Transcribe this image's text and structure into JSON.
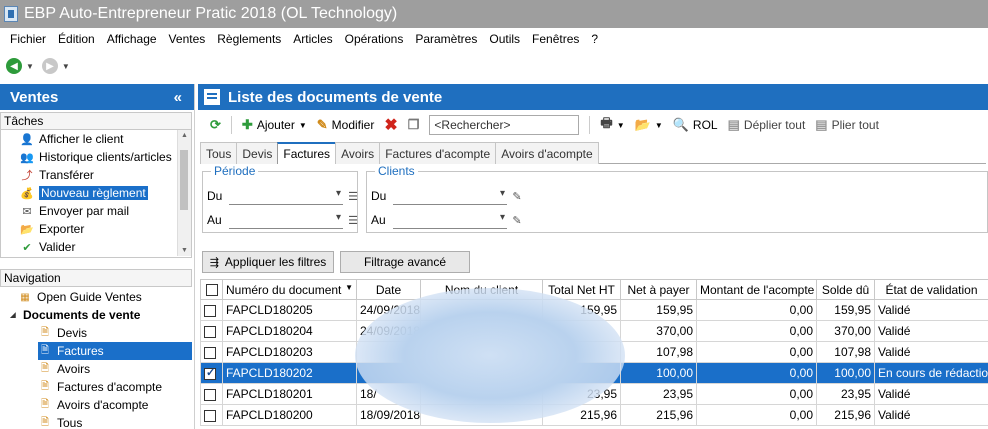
{
  "window": {
    "title": "EBP Auto-Entrepreneur Pratic 2018 (OL Technology)"
  },
  "menu": [
    "Fichier",
    "Édition",
    "Affichage",
    "Ventes",
    "Règlements",
    "Articles",
    "Opérations",
    "Paramètres",
    "Outils",
    "Fenêtres",
    "?"
  ],
  "left_panel": {
    "title": "Ventes",
    "collapse_glyph": "«",
    "tasks_label": "Tâches",
    "tasks": [
      {
        "label": "Afficher le client",
        "icon": "person-icon"
      },
      {
        "label": "Historique clients/articles",
        "icon": "people-icon"
      },
      {
        "label": "Transférer",
        "icon": "transfer-icon"
      },
      {
        "label": "Nouveau règlement",
        "icon": "payment-icon",
        "selected": true
      },
      {
        "label": "Envoyer par mail",
        "icon": "mail-icon"
      },
      {
        "label": "Exporter",
        "icon": "export-icon"
      },
      {
        "label": "Valider",
        "icon": "check-icon"
      }
    ],
    "navigation_label": "Navigation",
    "nav": [
      {
        "label": "Open Guide Ventes",
        "icon": "guide-icon"
      },
      {
        "label": "Documents de vente",
        "bold": true
      },
      {
        "label": "Devis",
        "icon": "document-icon"
      },
      {
        "label": "Factures",
        "icon": "document-icon",
        "selected": true
      },
      {
        "label": "Avoirs",
        "icon": "document-icon"
      },
      {
        "label": "Factures d'acompte",
        "icon": "document-icon"
      },
      {
        "label": "Avoirs d'acompte",
        "icon": "document-icon"
      },
      {
        "label": "Tous",
        "icon": "document-icon"
      }
    ]
  },
  "main": {
    "title": "Liste des documents de vente",
    "toolbar": {
      "add": "Ajouter",
      "edit": "Modifier",
      "search_placeholder": "<Rechercher>",
      "rol": "ROL",
      "expand": "Déplier tout",
      "collapse": "Plier tout"
    },
    "tabs": [
      "Tous",
      "Devis",
      "Factures",
      "Avoirs",
      "Factures d'acompte",
      "Avoirs d'acompte"
    ],
    "active_tab": "Factures",
    "filters": {
      "period_legend": "Période",
      "clients_legend": "Clients",
      "from": "Du",
      "to": "Au"
    },
    "buttons": {
      "apply": "Appliquer les filtres",
      "advanced": "Filtrage avancé"
    },
    "columns": [
      "Numéro du document",
      "Date",
      "Nom du client",
      "Total Net HT",
      "Net à payer",
      "Montant de l'acompte",
      "Solde dû",
      "État de validation"
    ],
    "rows": [
      {
        "num": "FAPCLD180205",
        "date": "24/09/2018",
        "client": "",
        "total": "159,95",
        "net": "159,95",
        "acompte": "0,00",
        "solde": "159,95",
        "etat": "Validé",
        "checked": false
      },
      {
        "num": "FAPCLD180204",
        "date": "24/09/2018",
        "client": "",
        "total": "",
        "net": "370,00",
        "acompte": "0,00",
        "solde": "370,00",
        "etat": "Validé",
        "checked": false
      },
      {
        "num": "FAPCLD180203",
        "date": "",
        "client": "",
        "total": "",
        "net": "107,98",
        "acompte": "0,00",
        "solde": "107,98",
        "etat": "Validé",
        "checked": false
      },
      {
        "num": "FAPCLD180202",
        "date": "",
        "client": "",
        "total": "",
        "net": "100,00",
        "acompte": "0,00",
        "solde": "100,00",
        "etat": "En cours de rédaction",
        "checked": true,
        "selected": true
      },
      {
        "num": "FAPCLD180201",
        "date": "18/",
        "client": "",
        "total": "23,95",
        "net": "23,95",
        "acompte": "0,00",
        "solde": "23,95",
        "etat": "Validé",
        "checked": false
      },
      {
        "num": "FAPCLD180200",
        "date": "18/09/2018",
        "client": "",
        "total": "215,96",
        "net": "215,96",
        "acompte": "0,00",
        "solde": "215,96",
        "etat": "Validé",
        "checked": false
      }
    ]
  },
  "colors": {
    "accent": "#1f6fbf",
    "selection": "#1a6fc9",
    "titlebar": "#9e9e9e"
  }
}
